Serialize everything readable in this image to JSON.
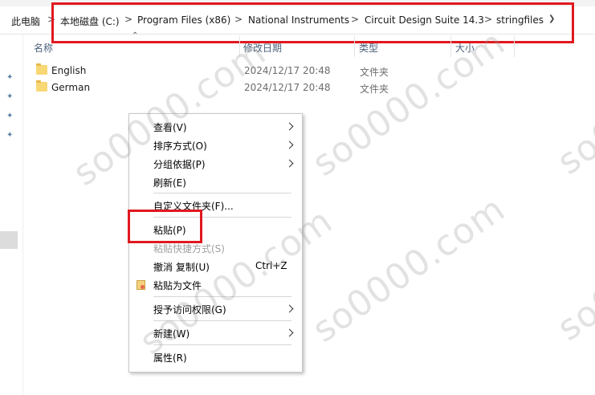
{
  "breadcrumb": {
    "items": [
      "此电脑",
      "本地磁盘 (C:)",
      "Program Files (x86)",
      "National Instruments",
      "Circuit Design Suite 14.3",
      "stringfiles"
    ],
    "separator": ">"
  },
  "columns": {
    "name": "名称",
    "modified": "修改日期",
    "type": "类型",
    "size": "大小"
  },
  "files": [
    {
      "name": "English",
      "modified": "2024/12/17 20:48",
      "type": "文件夹"
    },
    {
      "name": "German",
      "modified": "2024/12/17 20:48",
      "type": "文件夹"
    }
  ],
  "context_menu": {
    "view": "查看(V)",
    "sort": "排序方式(O)",
    "group": "分组依据(P)",
    "refresh": "刷新(E)",
    "customize": "自定义文件夹(F)...",
    "paste": "粘贴(P)",
    "paste_shortcut": "粘贴快捷方式(S)",
    "undo_copy": "撤消 复制(U)",
    "undo_shortcut": "Ctrl+Z",
    "paste_as_file": "粘贴为文件",
    "grant_access": "授予访问权限(G)",
    "new": "新建(W)",
    "properties": "属性(R)"
  },
  "watermark": "so0000.com",
  "colors": {
    "highlight_box": "#e0191f",
    "folder": "#f8d775",
    "header_text": "#4c607a"
  }
}
